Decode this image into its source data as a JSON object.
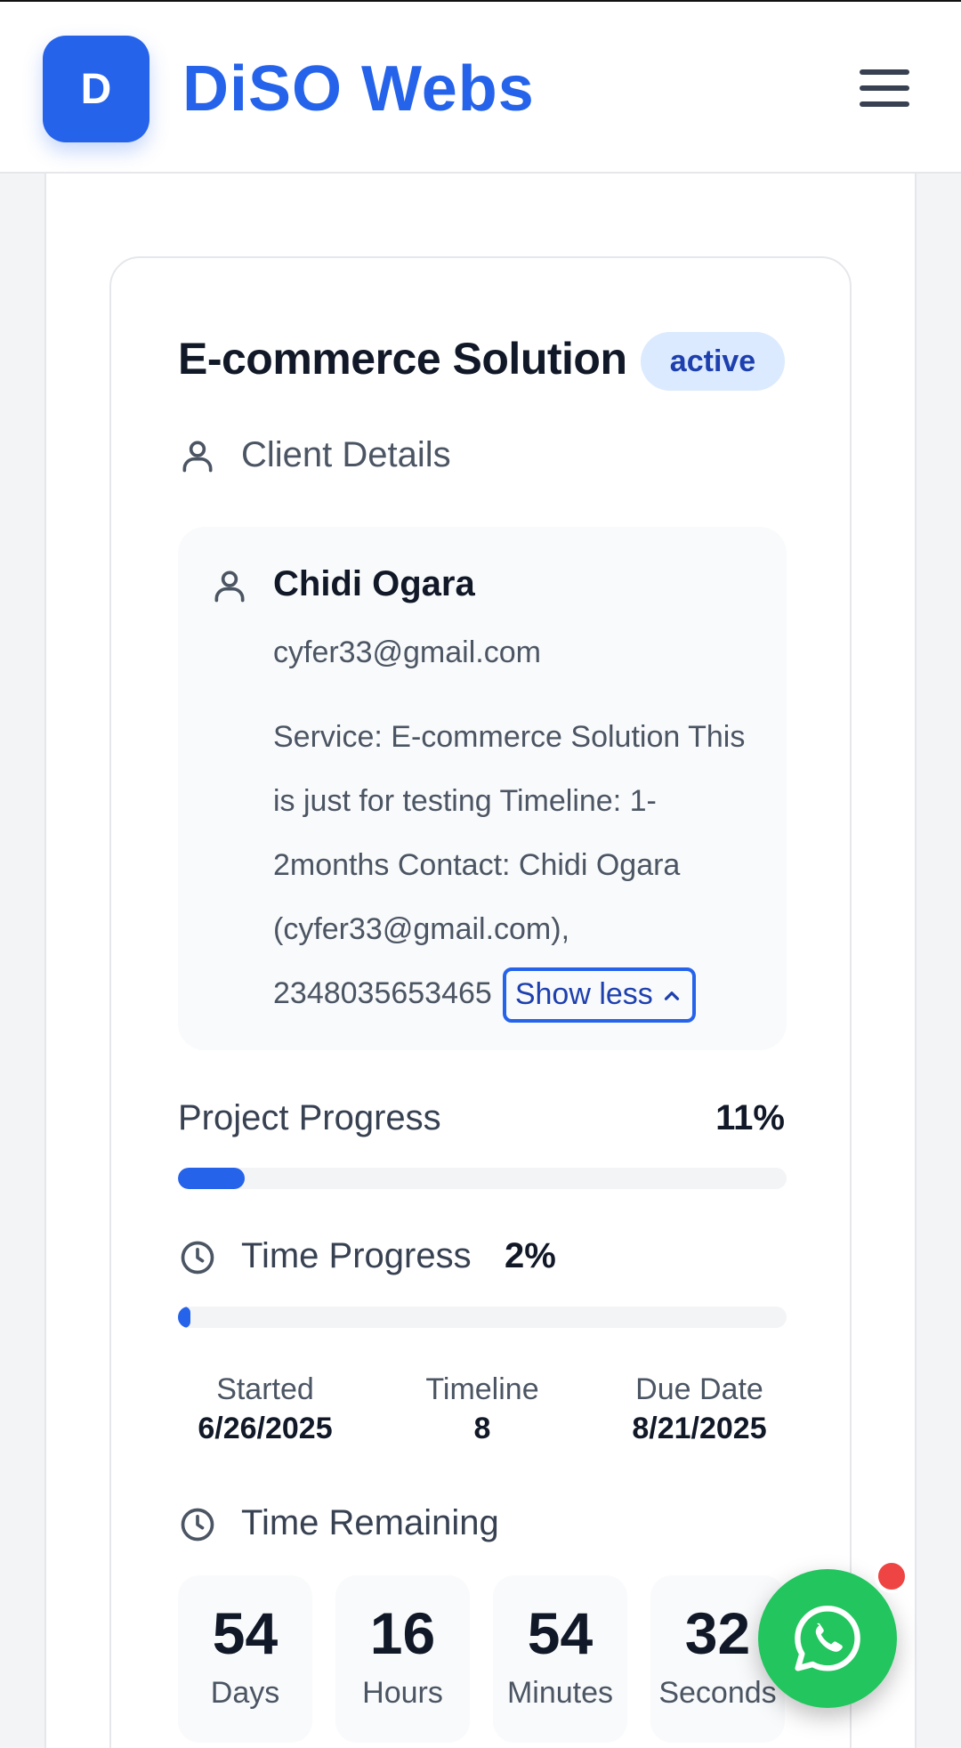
{
  "header": {
    "logo_letter": "D",
    "brand": "DiSO Webs"
  },
  "project": {
    "title": "E-commerce Solution",
    "status": "active",
    "client_section_label": "Client Details",
    "client": {
      "name": "Chidi Ogara",
      "email": "cyfer33@gmail.com",
      "description": "Service: E-commerce Solution This is just for testing Timeline: 1-2months Contact: Chidi Ogara (cyfer33@gmail.com), 2348035653465",
      "toggle_label": "Show less"
    },
    "project_progress": {
      "label": "Project Progress",
      "value_text": "11%",
      "fraction": 0.11
    },
    "time_progress": {
      "label": "Time Progress",
      "value_text": "2%",
      "fraction": 0.02
    },
    "dates": {
      "started_label": "Started",
      "started": "6/26/2025",
      "timeline_label": "Timeline",
      "timeline": "8",
      "due_label": "Due Date",
      "due": "8/21/2025"
    },
    "time_remaining": {
      "label": "Time Remaining",
      "units": [
        {
          "value": "54",
          "label": "Days"
        },
        {
          "value": "16",
          "label": "Hours"
        },
        {
          "value": "54",
          "label": "Minutes"
        },
        {
          "value": "32",
          "label": "Seconds"
        }
      ]
    }
  },
  "colors": {
    "brand": "#2563eb",
    "status_bg": "#dbeafe",
    "status_text": "#1e40af",
    "whatsapp": "#22c55e",
    "notification": "#ef4444"
  },
  "icons": {
    "menu": "hamburger-menu-icon",
    "client": "user-icon",
    "time": "clock-icon",
    "toggle": "chevron-up-icon",
    "chat": "whatsapp-icon"
  }
}
